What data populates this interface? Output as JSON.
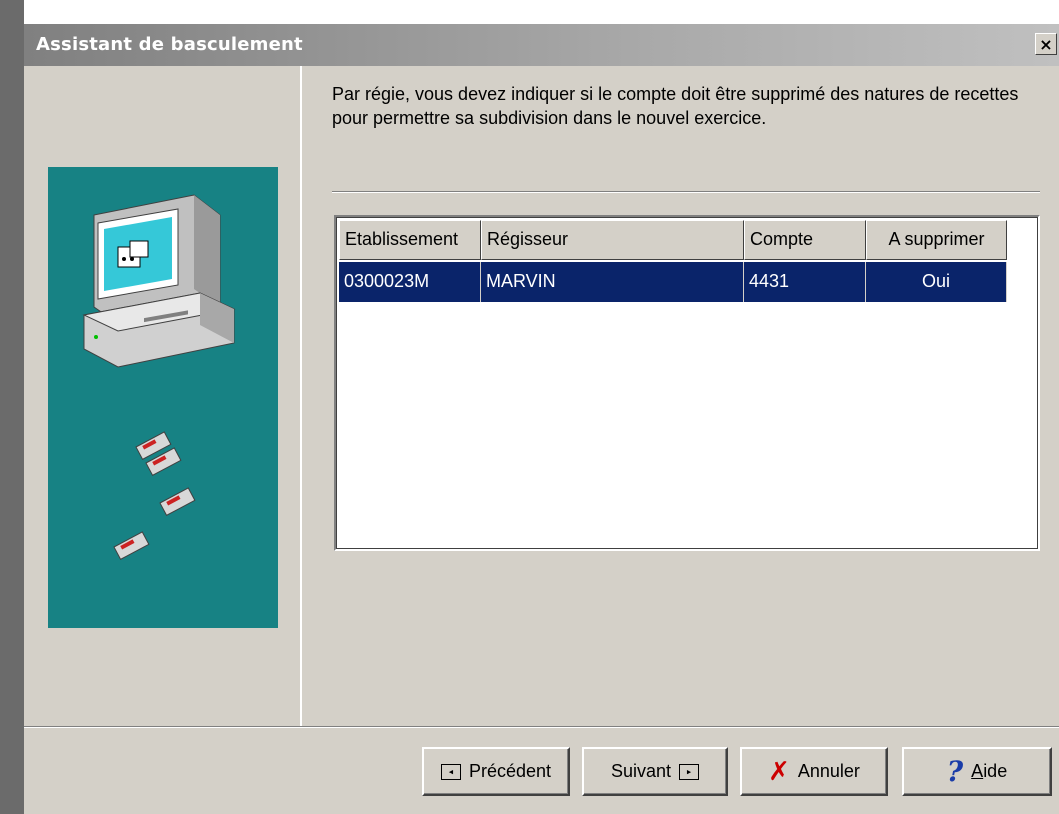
{
  "window": {
    "title": "Assistant de basculement",
    "close_glyph": "×"
  },
  "instruction": "Par régie, vous devez indiquer si le compte doit être supprimé des natures de recettes pour permettre sa subdivision dans le nouvel exercice.",
  "grid": {
    "columns": [
      "Etablissement",
      "Régisseur",
      "Compte",
      "A supprimer"
    ],
    "rows": [
      [
        "0300023M",
        "MARVIN",
        "4431",
        "Oui"
      ]
    ],
    "selected_row_color": "#0a246a"
  },
  "buttons": {
    "previous": "Précédent",
    "next": "Suivant",
    "cancel": "Annuler",
    "help_accel": "A",
    "help_rest": "ide"
  },
  "icons": {
    "previous": "arrow-left-box-icon",
    "next": "arrow-right-box-icon",
    "cancel": "red-x-icon",
    "help": "question-mark-icon",
    "illustration": "computer-with-floppy-disks-icon"
  },
  "colors": {
    "illustration_background": "#178284",
    "dialog_background": "#d4d0c8"
  }
}
